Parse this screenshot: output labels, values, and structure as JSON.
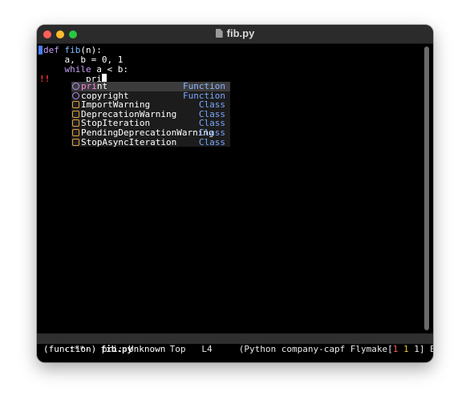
{
  "window": {
    "title": "fib.py"
  },
  "code": {
    "line1": {
      "kw": "def",
      "name": "fib",
      "args": "(n):"
    },
    "line2": "    a, b = 0, 1",
    "line3": {
      "indent": "    ",
      "kw": "while",
      "rest": " a < b:"
    },
    "line4": {
      "indent": "        ",
      "text": "pri"
    },
    "fringe_marker": "!!"
  },
  "completion": {
    "items": [
      {
        "match": "pri",
        "rest": "nt",
        "annotation": "Function",
        "kind": "function",
        "selected": true
      },
      {
        "match": "",
        "rest": "copyright",
        "annotation": "Function",
        "kind": "function",
        "selected": false
      },
      {
        "match": "",
        "rest": "ImportWarning",
        "annotation": "Class",
        "kind": "class",
        "selected": false
      },
      {
        "match": "",
        "rest": "DeprecationWarning",
        "annotation": "Class",
        "kind": "class",
        "selected": false
      },
      {
        "match": "",
        "rest": "StopIteration",
        "annotation": "Class",
        "kind": "class",
        "selected": false
      },
      {
        "match": "",
        "rest": "PendingDeprecationWarning",
        "annotation": "Class",
        "kind": "class",
        "selected": false
      },
      {
        "match": "",
        "rest": "StopAsyncIteration",
        "annotation": "Class",
        "kind": "class",
        "selected": false
      }
    ]
  },
  "modeline": {
    "status": "-:**-",
    "buffer": "fib.py",
    "position": "Top",
    "line": "L4",
    "modes_open": "(Python company-capf Flymake[",
    "fm_errors": "1",
    "fm_warnings": "1",
    "fm_notes": "1",
    "modes_close": "] ElDoc)",
    "tail": "[]"
  },
  "minibuffer": "(function) pri: Unknown",
  "colors": {
    "accent": "#7aa7ff",
    "error": "#ff3333",
    "keyword": "#c6a0f6",
    "match": "#e68ee0"
  }
}
